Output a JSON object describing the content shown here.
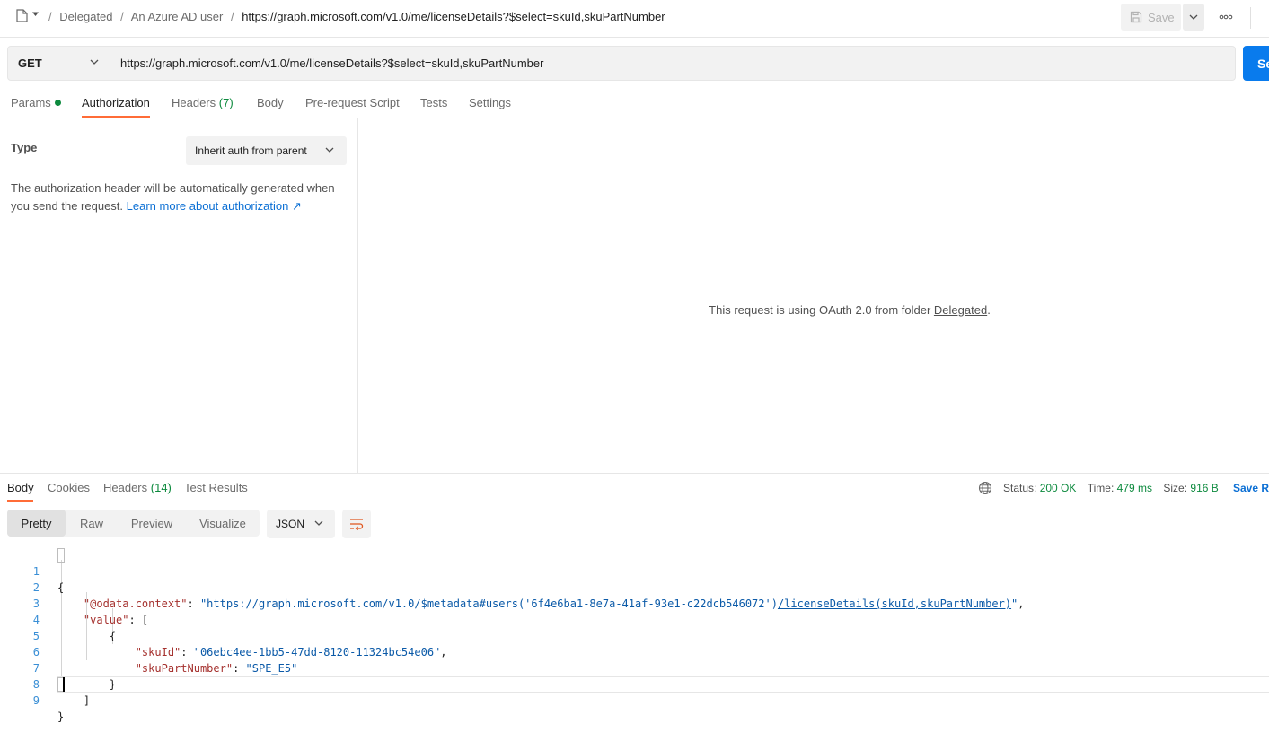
{
  "breadcrumb": {
    "folder": "Delegated",
    "request_folder": "An Azure AD user",
    "request_name": "https://graph.microsoft.com/v1.0/me/licenseDetails?$select=skuId,skuPartNumber",
    "separator": "/"
  },
  "toolbar": {
    "save_label": "Save",
    "more_label": "ooo"
  },
  "request": {
    "method": "GET",
    "url": "https://graph.microsoft.com/v1.0/me/licenseDetails?$select=skuId,skuPartNumber",
    "send_label": "Se"
  },
  "request_tabs": [
    {
      "label": "Params"
    },
    {
      "label": "Authorization"
    },
    {
      "label": "Headers",
      "count": "(7)"
    },
    {
      "label": "Body"
    },
    {
      "label": "Pre-request Script"
    },
    {
      "label": "Tests"
    },
    {
      "label": "Settings"
    }
  ],
  "auth": {
    "type_label": "Type",
    "type_value": "Inherit auth from parent",
    "description": "The authorization header will be automatically generated when you send the request. ",
    "learn_more": "Learn more about authorization ↗",
    "message_prefix": "This request is using OAuth 2.0 from folder ",
    "message_folder": "Delegated",
    "message_suffix": "."
  },
  "response_tabs": [
    {
      "label": "Body"
    },
    {
      "label": "Cookies"
    },
    {
      "label": "Headers",
      "count": "(14)"
    },
    {
      "label": "Test Results"
    }
  ],
  "response_meta": {
    "status_label": "Status:",
    "status_value": "200 OK",
    "time_label": "Time:",
    "time_value": "479 ms",
    "size_label": "Size:",
    "size_value": "916 B",
    "save_label": "Save R"
  },
  "view_modes": [
    "Pretty",
    "Raw",
    "Preview",
    "Visualize"
  ],
  "format": "JSON",
  "response_body": {
    "context_key": "\"@odata.context\"",
    "context_value_a": "\"https://graph.microsoft.com/v1.0/$metadata#users('6f4e6ba1-8e7a-41af-93e1-c22dcb546072')",
    "context_value_b": "/licenseDetails(skuId,skuPartNumber)",
    "context_value_c": "\"",
    "value_key": "\"value\"",
    "sku_id_key": "\"skuId\"",
    "sku_id_value": "\"06ebc4ee-1bb5-47dd-8120-11324bc54e06\"",
    "sku_part_key": "\"skuPartNumber\"",
    "sku_part_value": "\"SPE_E5\"",
    "line_numbers": [
      "1",
      "2",
      "3",
      "4",
      "5",
      "6",
      "7",
      "8",
      "9"
    ]
  },
  "colors": {
    "accent": "#ff6c37",
    "send": "#097bed",
    "success": "#0d8a3e",
    "link": "#0b6fd4"
  }
}
